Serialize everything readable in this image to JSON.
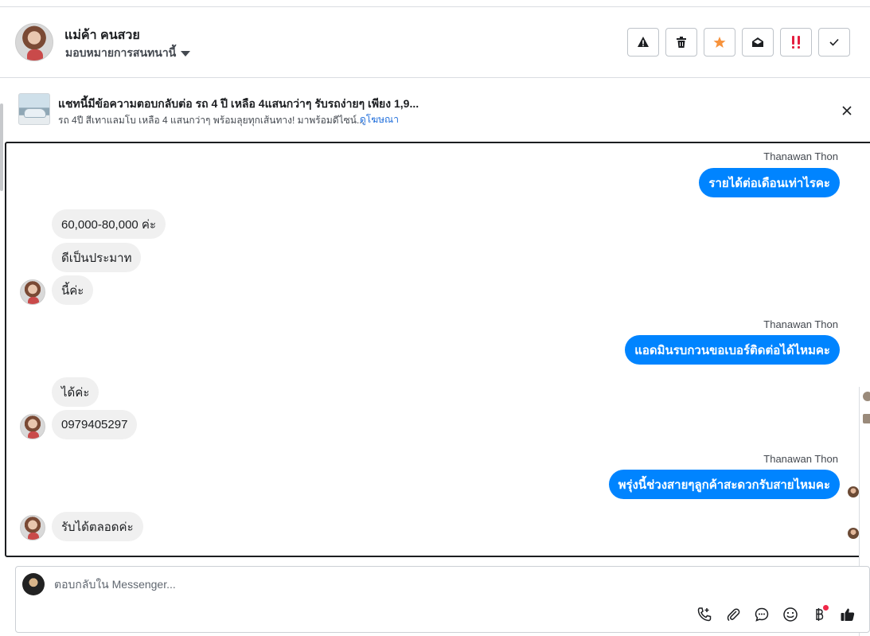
{
  "header": {
    "contact_name": "แม่ค้า คนสวย",
    "assign_label": "มอบหมายการสนทนานี้",
    "actions": [
      {
        "name": "spam-button",
        "icon": "warning-icon"
      },
      {
        "name": "delete-button",
        "icon": "trash-icon"
      },
      {
        "name": "star-button",
        "icon": "star-icon",
        "color": "#f7923b"
      },
      {
        "name": "mark-unread-button",
        "icon": "open-envelope-icon"
      },
      {
        "name": "follow-up-button",
        "icon": "double-exclamation-icon",
        "color": "#e41e3f"
      },
      {
        "name": "mark-done-button",
        "icon": "check-icon"
      }
    ]
  },
  "ad": {
    "title": "แชทนี้มีข้อความตอบกลับต่อ รถ 4 ปี เหลือ 4แสนกว่าๆ รับรถง่ายๆ เพียง 1,9...",
    "description": "รถ 4ปี สีเทาแลมโบ เหลือ 4 แสนกว่าๆ พร้อมลุยทุกเส้นทาง! มาพร้อมดีไซน์...",
    "link": "ดูโฆษณา"
  },
  "messages": [
    {
      "sender": "Thanawan Thon",
      "outgoing": true,
      "text": "รายได้ต่อเดือนเท่าไรคะ"
    },
    {
      "outgoing": false,
      "text": "60,000-80,000 ค่ะ"
    },
    {
      "outgoing": false,
      "text": "ดีเป็นประมาท"
    },
    {
      "outgoing": false,
      "text": "นี้ค่ะ"
    },
    {
      "sender": "Thanawan Thon",
      "outgoing": true,
      "text": "แอดมินรบกวนขอเบอร์ติดต่อได้ไหมคะ"
    },
    {
      "outgoing": false,
      "text": "ได้ค่ะ"
    },
    {
      "outgoing": false,
      "text": "0979405297"
    },
    {
      "sender": "Thanawan Thon",
      "outgoing": true,
      "text": "พรุ่งนี้ช่วงสายๆลูกค้าสะดวกรับสายไหมคะ"
    },
    {
      "outgoing": false,
      "text": "รับได้ตลอดค่ะ"
    }
  ],
  "composer": {
    "placeholder": "ตอบกลับใน Messenger...",
    "tools": [
      "call-icon",
      "attach-icon",
      "saved-reply-icon",
      "emoji-icon",
      "payment-icon",
      "like-icon"
    ]
  },
  "colors": {
    "accent": "#0084ff",
    "incoming_bubble": "#f0f0f0",
    "link": "#216fdb"
  }
}
